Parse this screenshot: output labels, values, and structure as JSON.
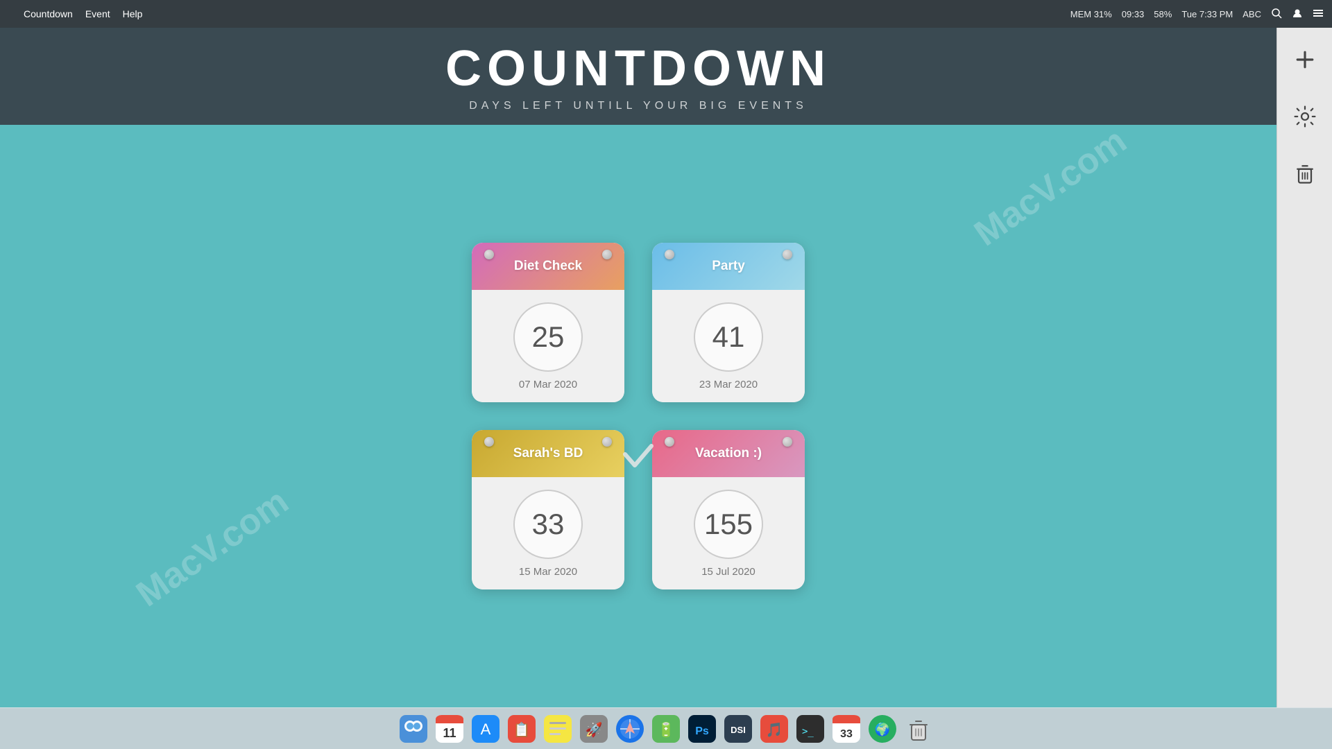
{
  "menubar": {
    "apple": "",
    "app_name": "Countdown",
    "menu_items": [
      "Event",
      "Help"
    ],
    "mem": "MEM 31%",
    "time": "09:33",
    "battery": "58%",
    "datetime": "Tue 7:33 PM",
    "abc": "ABC"
  },
  "header": {
    "title": "COUNTDOWN",
    "subtitle": "DAYS LEFT UNTILL YOUR BIG EVENTS"
  },
  "sidebar": {
    "add_label": "+",
    "settings_label": "⚙",
    "delete_label": "🗑"
  },
  "cards": [
    {
      "id": "diet-check",
      "title": "Diet Check",
      "number": "25",
      "date": "07 Mar 2020",
      "color_class": "card-diet"
    },
    {
      "id": "party",
      "title": "Party",
      "number": "41",
      "date": "23 Mar 2020",
      "color_class": "card-party"
    },
    {
      "id": "sarahs-bd",
      "title": "Sarah's BD",
      "number": "33",
      "date": "15 Mar 2020",
      "color_class": "card-sarahbd"
    },
    {
      "id": "vacation",
      "title": "Vacation :)",
      "number": "155",
      "date": "15 Jul 2020",
      "color_class": "card-vacation"
    }
  ],
  "watermarks": [
    "MacV.com",
    "MacV.com"
  ],
  "dock": {
    "items": [
      "🔍",
      "📅",
      "🛍",
      "📋",
      "🗂",
      "🚀",
      "🌐",
      "🔋",
      "🎨",
      "🖼",
      "🎵",
      "💻",
      "🔢",
      "🌐",
      "🗑"
    ]
  }
}
